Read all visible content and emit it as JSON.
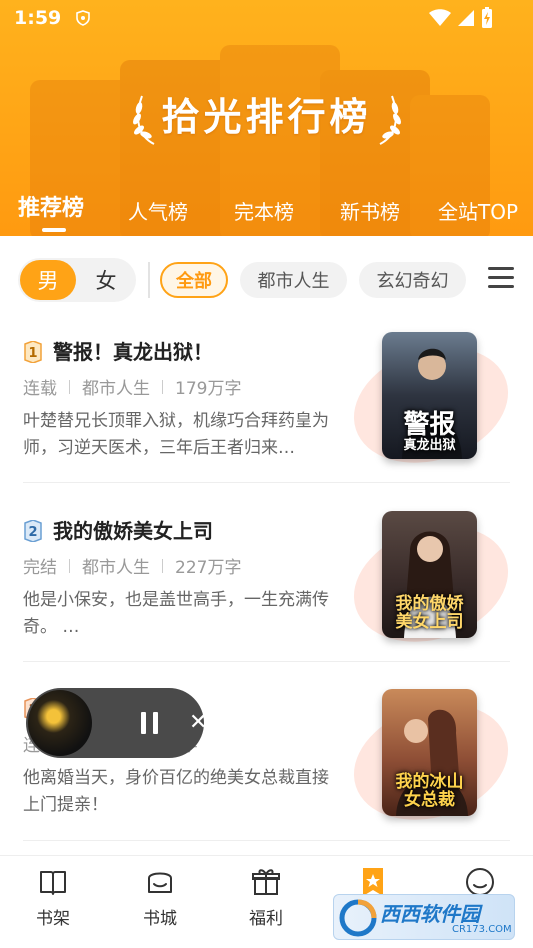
{
  "status_bar": {
    "time": "1:59"
  },
  "header": {
    "title": "拾光排行榜",
    "tabs": [
      {
        "label": "推荐榜",
        "active": true
      },
      {
        "label": "人气榜"
      },
      {
        "label": "完本榜"
      },
      {
        "label": "新书榜"
      },
      {
        "label": "全站TOP"
      }
    ]
  },
  "filters": {
    "gender": [
      {
        "label": "男",
        "active": true
      },
      {
        "label": "女"
      }
    ],
    "categories": [
      {
        "label": "全部",
        "active": true
      },
      {
        "label": "都市人生"
      },
      {
        "label": "玄幻奇幻"
      }
    ]
  },
  "books": [
    {
      "rank": "1",
      "title": "警报！真龙出狱！",
      "status": "连载",
      "category": "都市人生",
      "words": "179万字",
      "desc": "叶楚替兄长顶罪入狱，机缘巧合拜药皇为师，习逆天医术，三年后王者归来…",
      "cover_text": [
        "警报",
        "真龙出狱"
      ],
      "badge_color": "#f2a23a"
    },
    {
      "rank": "2",
      "title": "我的傲娇美女上司",
      "status": "完结",
      "category": "都市人生",
      "words": "227万字",
      "desc": "他是小保安，也是盖世高手，一生充满传奇。 …",
      "cover_text": [
        "我的傲娇",
        "美女上司"
      ],
      "badge_color": "#6a9fd3"
    },
    {
      "rank": "3",
      "title": "",
      "status": "连",
      "category": "",
      "words": "万字",
      "desc": "他离婚当天，身价百亿的绝美女总裁直接上门提亲！",
      "cover_text": [
        "我的冰山",
        "女总裁"
      ],
      "badge_color": "#e8945a"
    }
  ],
  "player": {
    "state": "playing"
  },
  "bottom_nav": [
    {
      "label": "书架",
      "icon": "book-open-icon"
    },
    {
      "label": "书城",
      "icon": "store-icon"
    },
    {
      "label": "福利",
      "icon": "gift-icon"
    },
    {
      "label": "",
      "icon": "ranking-bookmark-icon",
      "active": true
    },
    {
      "label": "",
      "icon": "profile-icon"
    }
  ],
  "watermark": {
    "text": "西西软件园",
    "sub": "CR173.COM"
  },
  "colors": {
    "accent": "#ffa316",
    "header_bg": "#ffa516"
  }
}
